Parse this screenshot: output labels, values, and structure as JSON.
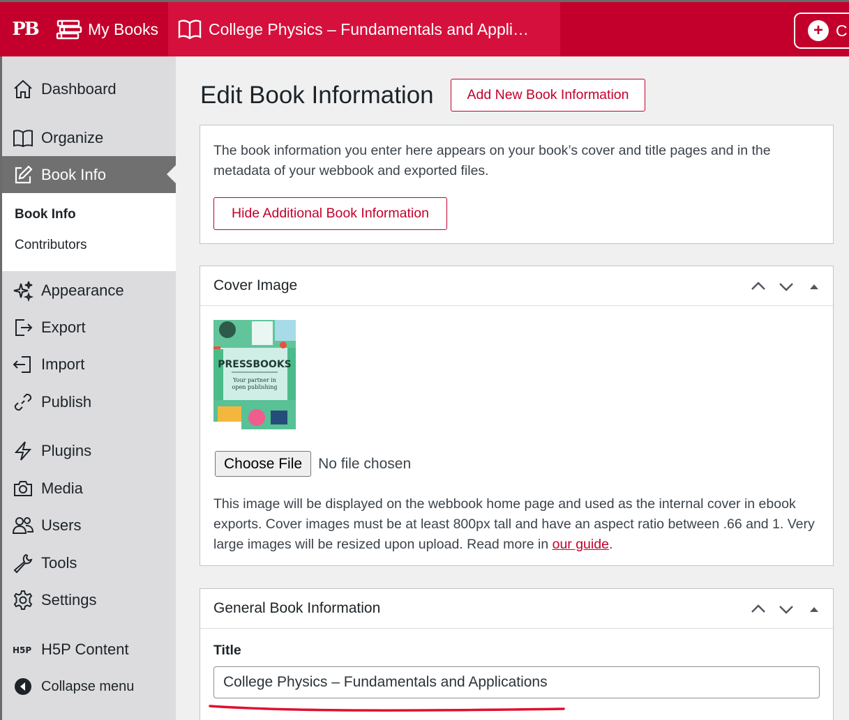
{
  "topbar": {
    "logo": "PB",
    "my_books": "My Books",
    "book_title": "College Physics – Fundamentals and Appli…",
    "new_label": "C"
  },
  "sidebar": {
    "items": [
      {
        "label": "Dashboard",
        "icon": "home-icon"
      },
      {
        "label": "Organize",
        "icon": "book-icon"
      },
      {
        "label": "Book Info",
        "icon": "edit-icon"
      },
      {
        "label": "Appearance",
        "icon": "sparkles-icon"
      },
      {
        "label": "Export",
        "icon": "export-icon"
      },
      {
        "label": "Import",
        "icon": "import-icon"
      },
      {
        "label": "Publish",
        "icon": "link-icon"
      },
      {
        "label": "Plugins",
        "icon": "bolt-icon"
      },
      {
        "label": "Media",
        "icon": "camera-icon"
      },
      {
        "label": "Users",
        "icon": "users-icon"
      },
      {
        "label": "Tools",
        "icon": "wrench-icon"
      },
      {
        "label": "Settings",
        "icon": "gear-icon"
      },
      {
        "label": "H5P Content",
        "icon": "h5p-icon"
      },
      {
        "label": "Collapse menu",
        "icon": "collapse-icon"
      }
    ],
    "submenu": [
      "Book Info",
      "Contributors"
    ]
  },
  "main": {
    "title": "Edit Book Information",
    "add_new_button": "Add New Book Information",
    "intro_text": "The book information you enter here appears on your book’s cover and title pages and in the metadata of your webbook and exported files.",
    "hide_button": "Hide Additional Book Information",
    "cover_panel": {
      "heading": "Cover Image",
      "cover_title": "PRESSBOOKS",
      "cover_tagline_1": "Your partner in",
      "cover_tagline_2": "open publishing",
      "choose_file": "Choose File",
      "no_file": "No file chosen",
      "help_text": "This image will be displayed on the webbook home page and used as the internal cover in ebook exports. Cover images must be at least 800px tall and have an aspect ratio between .66 and 1. Very large images will be resized upon upload. Read more in ",
      "guide_link": "our guide",
      "help_end": "."
    },
    "general_panel": {
      "heading": "General Book Information",
      "title_label": "Title",
      "title_value": "College Physics – Fundamentals and Applications"
    }
  },
  "colors": {
    "brand": "#c3002b",
    "annotation_underline": "#e0102e"
  }
}
